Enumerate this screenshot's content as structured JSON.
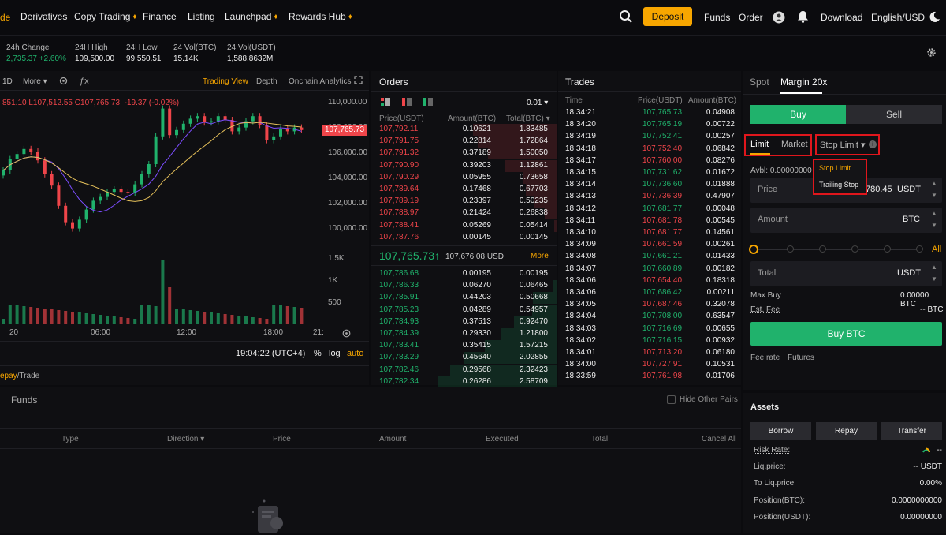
{
  "nav": {
    "logo_fragment": "de",
    "items": [
      {
        "label": "Derivatives",
        "fire": false
      },
      {
        "label": "Copy Trading",
        "fire": true
      },
      {
        "label": "Finance",
        "fire": false
      },
      {
        "label": "Listing",
        "fire": false
      },
      {
        "label": "Launchpad",
        "fire": true
      },
      {
        "label": "Rewards Hub",
        "fire": true
      }
    ],
    "deposit": "Deposit",
    "funds": "Funds",
    "order": "Order",
    "download": "Download",
    "language": "English/USD"
  },
  "stats": [
    {
      "label": "24h Change",
      "value": "2,735.37 +2.60%",
      "color": "green"
    },
    {
      "label": "24H High",
      "value": "109,500.00",
      "color": "white"
    },
    {
      "label": "24H Low",
      "value": "99,550.51",
      "color": "white"
    },
    {
      "label": "24 Vol(BTC)",
      "value": "15.14K",
      "color": "white"
    },
    {
      "label": "24 Vol(USDT)",
      "value": "1,588.8632M",
      "color": "white"
    }
  ],
  "chart": {
    "interval": "1D",
    "more": "More",
    "views": [
      "Trading View",
      "Depth",
      "Onchain Analytics"
    ],
    "ohlc_prefix": "851.10",
    "ohlc_l": "L107,512.55",
    "ohlc_c": "C107,765.73",
    "ohlc_change": "-19.37 (-0.02%)",
    "price_ticks": [
      "110,000.00",
      "108,000.00",
      "106,000.00",
      "104,000.00",
      "102,000.00",
      "100,000.00"
    ],
    "current_price": "107,765.73",
    "volume_ticks": [
      "1.5K",
      "1K",
      "500"
    ],
    "time_ticks": [
      "20",
      "06:00",
      "12:00",
      "18:00",
      "21:"
    ],
    "clock": "19:04:22 (UTC+4)",
    "pct": "%",
    "log": "log",
    "auto": "auto",
    "subnav_part1": "epay",
    "subnav_part2": "/Trade"
  },
  "orders": {
    "title": "Orders",
    "precision": "0.01",
    "columns": [
      "Price(USDT)",
      "Amount(BTC)",
      "Total(BTC)"
    ],
    "asks": [
      [
        "107,792.11",
        "0.10621",
        "1.83485",
        0.71
      ],
      [
        "107,791.75",
        "0.22814",
        "1.72864",
        0.67
      ],
      [
        "107,791.32",
        "0.37189",
        "1.50050",
        0.58
      ],
      [
        "107,790.90",
        "0.39203",
        "1.12861",
        0.44
      ],
      [
        "107,790.29",
        "0.05955",
        "0.73658",
        0.29
      ],
      [
        "107,789.64",
        "0.17468",
        "0.67703",
        0.26
      ],
      [
        "107,789.19",
        "0.23397",
        "0.50235",
        0.19
      ],
      [
        "107,788.97",
        "0.21424",
        "0.26838",
        0.1
      ],
      [
        "107,788.41",
        "0.05269",
        "0.05414",
        0.02
      ],
      [
        "107,787.76",
        "0.00145",
        "0.00145",
        0.0
      ]
    ],
    "mid_price": "107,765.73",
    "mid_arrow": "↑",
    "mid_usd": "107,676.08 USD",
    "more": "More",
    "bids": [
      [
        "107,786.68",
        "0.00195",
        "0.00195",
        0.0
      ],
      [
        "107,786.33",
        "0.06270",
        "0.06465",
        0.03
      ],
      [
        "107,785.91",
        "0.44203",
        "0.50668",
        0.2
      ],
      [
        "107,785.23",
        "0.04289",
        "0.54957",
        0.21
      ],
      [
        "107,784.93",
        "0.37513",
        "0.92470",
        0.36
      ],
      [
        "107,784.39",
        "0.29330",
        "1.21800",
        0.47
      ],
      [
        "107,783.41",
        "0.35415",
        "1.57215",
        0.61
      ],
      [
        "107,783.29",
        "0.45640",
        "2.02855",
        0.78
      ],
      [
        "107,782.46",
        "0.29568",
        "2.32423",
        0.9
      ],
      [
        "107,782.34",
        "0.26286",
        "2.58709",
        1.0
      ]
    ]
  },
  "trades": {
    "title": "Trades",
    "columns": [
      "Time",
      "Price(USDT)",
      "Amount(BTC)"
    ],
    "rows": [
      [
        "18:34:21",
        "107,765.73",
        "0.04908",
        "g"
      ],
      [
        "18:34:20",
        "107,765.19",
        "0.00722",
        "g"
      ],
      [
        "18:34:19",
        "107,752.41",
        "0.00257",
        "g"
      ],
      [
        "18:34:18",
        "107,752.40",
        "0.06842",
        "r"
      ],
      [
        "18:34:17",
        "107,760.00",
        "0.08276",
        "r"
      ],
      [
        "18:34:15",
        "107,731.62",
        "0.01672",
        "g"
      ],
      [
        "18:34:14",
        "107,736.60",
        "0.01888",
        "g"
      ],
      [
        "18:34:13",
        "107,736.39",
        "0.47907",
        "r"
      ],
      [
        "18:34:12",
        "107,681.77",
        "0.00048",
        "g"
      ],
      [
        "18:34:11",
        "107,681.78",
        "0.00545",
        "r"
      ],
      [
        "18:34:10",
        "107,681.77",
        "0.14561",
        "r"
      ],
      [
        "18:34:09",
        "107,661.59",
        "0.00261",
        "r"
      ],
      [
        "18:34:08",
        "107,661.21",
        "0.01433",
        "g"
      ],
      [
        "18:34:07",
        "107,660.89",
        "0.00182",
        "g"
      ],
      [
        "18:34:06",
        "107,654.40",
        "0.18318",
        "r"
      ],
      [
        "18:34:06",
        "107,686.42",
        "0.00211",
        "g"
      ],
      [
        "18:34:05",
        "107,687.46",
        "0.32078",
        "r"
      ],
      [
        "18:34:04",
        "107,708.00",
        "0.63547",
        "g"
      ],
      [
        "18:34:03",
        "107,716.69",
        "0.00655",
        "g"
      ],
      [
        "18:34:02",
        "107,716.15",
        "0.00932",
        "g"
      ],
      [
        "18:34:01",
        "107,713.20",
        "0.06180",
        "r"
      ],
      [
        "18:34:00",
        "107,727.91",
        "0.10531",
        "r"
      ],
      [
        "18:33:59",
        "107,761.98",
        "0.01706",
        "r"
      ]
    ]
  },
  "trade_panel": {
    "tabs": [
      "Spot",
      "Margin 20x"
    ],
    "buy": "Buy",
    "sell": "Sell",
    "order_types": [
      "Limit",
      "Market",
      "Stop Limit"
    ],
    "avbl": "Avbl: 0.00000000 U",
    "dropdown": [
      "Stop Limit",
      "Trailing Stop"
    ],
    "price_label": "Price",
    "price_value": "780.45",
    "price_unit": "USDT",
    "amount_label": "Amount",
    "amount_unit": "BTC",
    "all": "All",
    "total_label": "Total",
    "total_unit": "USDT",
    "max_buy_label": "Max Buy",
    "max_buy_value": "0.00000 BTC",
    "est_fee_label": "Est. Fee",
    "est_fee_value": "-- BTC",
    "buy_btc": "Buy BTC",
    "fee_rate": "Fee rate",
    "futures": "Futures"
  },
  "funds": {
    "tab": "Funds",
    "hide_pairs": "Hide Other Pairs",
    "columns": [
      "Type",
      "Direction",
      "Price",
      "Amount",
      "Executed",
      "Total",
      "Cancel All"
    ]
  },
  "assets": {
    "title": "Assets",
    "buttons": [
      "Borrow",
      "Repay",
      "Transfer"
    ],
    "rows": [
      [
        "Risk Rate:",
        "--"
      ],
      [
        "Liq.price:",
        "-- USDT"
      ],
      [
        "To Liq.price:",
        "0.00%"
      ],
      [
        "Position(BTC):",
        "0.0000000000"
      ],
      [
        "Position(USDT):",
        "0.00000000"
      ]
    ]
  },
  "colors": {
    "accent": "#f7a600",
    "buy": "#20b26c",
    "sell": "#ef454a",
    "highlight": "#e0161c"
  }
}
